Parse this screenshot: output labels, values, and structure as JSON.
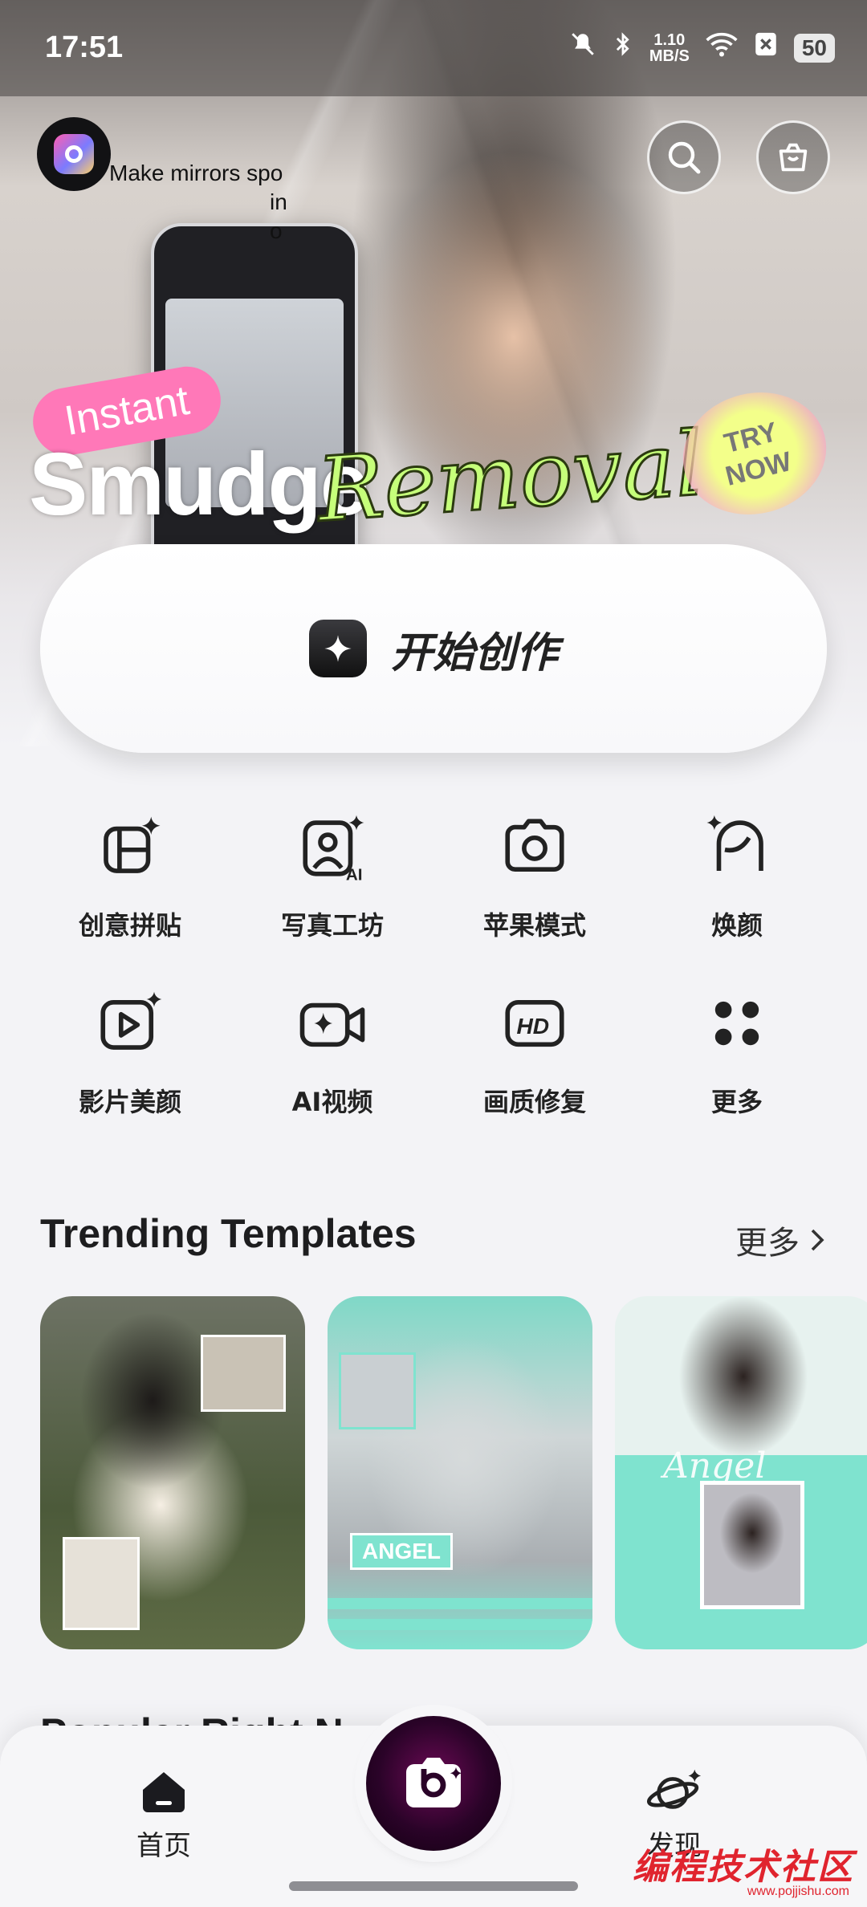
{
  "status_bar": {
    "time": "17:51",
    "net_speed_value": "1.10",
    "net_speed_unit": "MB/S",
    "battery": "50",
    "icons": [
      "mute-icon",
      "bluetooth-icon",
      "wifi-icon",
      "sim-off-icon",
      "battery-icon"
    ]
  },
  "banner": {
    "tagline_part1": "Make mirrors spo",
    "tagline_part2": "in o",
    "instant": "Instant",
    "smudge": "Smudge",
    "removal": "Removal",
    "try_now": "TRY\nNOW"
  },
  "cta": {
    "label": "开始创作"
  },
  "features": [
    {
      "label": "创意拼贴",
      "icon": "collage-icon"
    },
    {
      "label": "写真工坊",
      "icon": "ai-portrait-icon"
    },
    {
      "label": "苹果模式",
      "icon": "camera-icon"
    },
    {
      "label": "焕颜",
      "icon": "face-retouch-icon"
    },
    {
      "label": "影片美颜",
      "icon": "video-beauty-icon"
    },
    {
      "label": "AI视频",
      "icon": "ai-video-icon"
    },
    {
      "label": "画质修复",
      "icon": "hd-icon"
    },
    {
      "label": "更多",
      "icon": "more-dots-icon"
    }
  ],
  "trending": {
    "title": "Trending Templates",
    "more": "更多",
    "card2_tag": "ANGEL",
    "card3_script": "Angel"
  },
  "popular_peek": "Popular Right N",
  "nav": {
    "home": "首页",
    "discover": "发现"
  },
  "watermark": {
    "text": "编程技术社区",
    "url": "www.pojjishu.com"
  },
  "colors": {
    "background": "#f3f3f6",
    "fab": "#2a0328",
    "accent_mint": "#7fe3cf",
    "watermark_red": "#e0242e"
  }
}
